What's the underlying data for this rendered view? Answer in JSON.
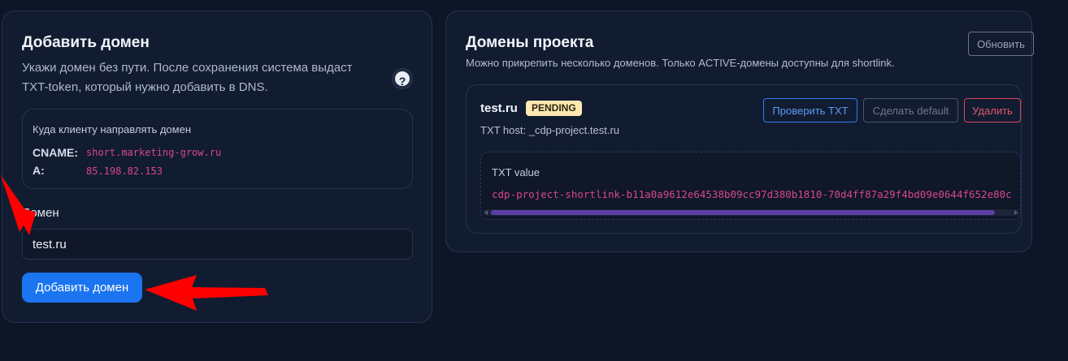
{
  "add_domain": {
    "title": "Добавить домен",
    "description": "Укажи домен без пути. После сохранения система выдаст TXT-token, который нужно добавить в DNS.",
    "help_label": "?",
    "dns_box": {
      "title": "Куда клиенту направлять домен",
      "records": [
        {
          "key": "CNAME:",
          "value": "short.marketing-grow.ru"
        },
        {
          "key": "A:",
          "value": "85.198.82.153"
        }
      ]
    },
    "domain_label": "Домен",
    "domain_value": "test.ru",
    "submit_label": "Добавить домен"
  },
  "project_domains": {
    "title": "Домены проекта",
    "description": "Можно прикрепить несколько доменов. Только ACTIVE-домены доступны для shortlink.",
    "refresh_label": "Обновить",
    "domains": [
      {
        "name": "test.ru",
        "status": "PENDING",
        "txt_host": "TXT host: _cdp-project.test.ru",
        "verify_label": "Проверить TXT",
        "default_label": "Сделать default",
        "delete_label": "Удалить",
        "txt_label": "TXT value",
        "txt_value": "cdp-project-shortlink-b11a0a9612e64538b09cc97d380b1810-70d4ff87a29f4bd09e0644f652e80c"
      }
    ]
  },
  "colors": {
    "background": "#0d1526",
    "card": "#121c31",
    "accent": "#1b74f0",
    "code": "#d9468f",
    "pending_badge": "#fde8b0",
    "danger": "#e0596a",
    "annotation_arrow": "#ff0000"
  },
  "icons": [
    "help-icon",
    "annotation-arrow"
  ]
}
